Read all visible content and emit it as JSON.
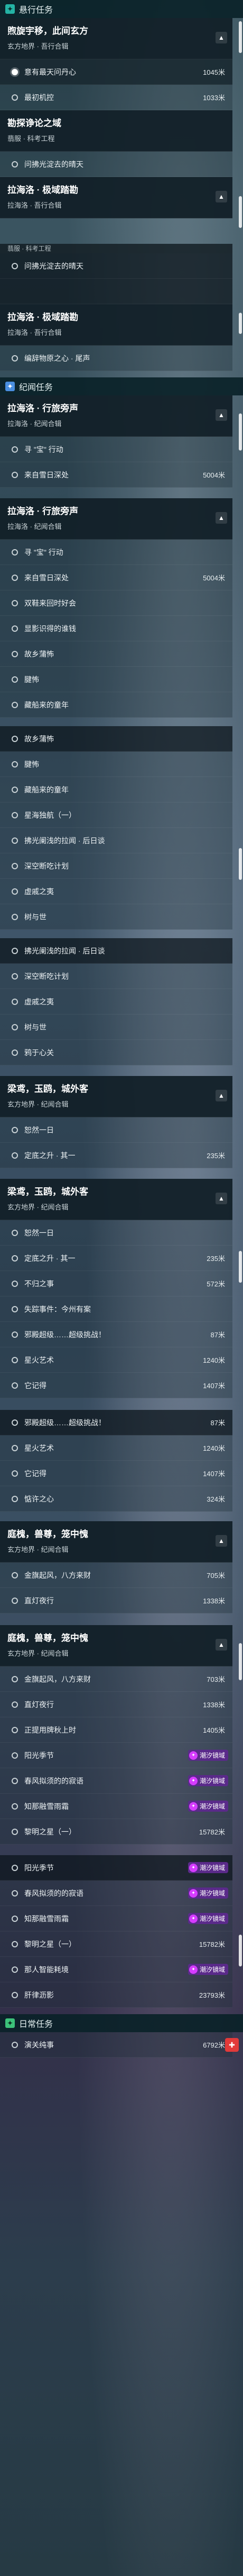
{
  "sections": {
    "daily": "悬行任务",
    "legend": "纪闻任务",
    "routine": "日常任务"
  },
  "quests": {
    "q1": {
      "title": "煦旋宇移，此间玄方",
      "sub": "玄方地界 · 吾行合辑"
    },
    "q2": {
      "title": "勘探诤论之域",
      "sub": "翡服 · 科考工程"
    },
    "q3": {
      "title": "拉海洛 · 极域踏勘",
      "sub": "拉海洛 · 吾行合辑"
    },
    "q4": {
      "title": "拉海洛 · 极域踏勘",
      "sub": "拉海洛 · 吾行合辑"
    },
    "q5": {
      "title": "拉海洛 · 行旅旁声",
      "sub": "拉海洛 · 纪闻合辑"
    },
    "q6": {
      "title": "拉海洛 · 行旅旁声",
      "sub": "拉海洛 · 纪闻合辑"
    },
    "q7": {
      "title": "梁鸢，玉鸥，城外客",
      "sub": "玄方地界 · 纪闻合辑"
    },
    "q8": {
      "title": "梁鸢，玉鸥，城外客",
      "sub": "玄方地界 · 纪闻合辑"
    },
    "q9": {
      "title": "庭槐，兽尊，笼中愧",
      "sub": "玄方地界 · 纪闻合辑"
    },
    "q10": {
      "title": "庭槐，兽尊，笼中愧",
      "sub": "玄方地界 · 纪闻合辑"
    }
  },
  "partial": {
    "p1": "翡服 · 科考工程"
  },
  "rows": {
    "r1": {
      "label": "意有最天问丹心",
      "dist": "1045米"
    },
    "r2": {
      "label": "最初机控",
      "dist": "1033米"
    },
    "r3": {
      "label": "问拂光淀去的晴天",
      "dist": ""
    },
    "r4": {
      "label": "问拂光淀去的晴天",
      "dist": ""
    },
    "r5": {
      "label": "编辞物原之心 · 尾声",
      "dist": ""
    },
    "r6": {
      "label": "寻 \"宝\" 行动",
      "dist": ""
    },
    "r7": {
      "label": "来自雪日深处",
      "dist": "5004米"
    },
    "r8": {
      "label": "寻 \"宝\" 行动",
      "dist": ""
    },
    "r9": {
      "label": "来自雪日深处",
      "dist": "5004米"
    },
    "r10": {
      "label": "双鞋来回时好会",
      "dist": ""
    },
    "r11": {
      "label": "显影识得的谁钱",
      "dist": ""
    },
    "r12": {
      "label": "故乡蒲怖",
      "dist": ""
    },
    "r13": {
      "label": "腱怖",
      "dist": ""
    },
    "r14": {
      "label": "藏船来的童年",
      "dist": ""
    },
    "r15": {
      "label": "故乡蒲怖",
      "dist": ""
    },
    "r16": {
      "label": "腱怖",
      "dist": ""
    },
    "r17": {
      "label": "藏船来的童年",
      "dist": ""
    },
    "r18": {
      "label": "星海独航（一）",
      "dist": ""
    },
    "r19": {
      "label": "拂光阑浅的拉闻 · 后日谈",
      "dist": ""
    },
    "r20": {
      "label": "深空断吃计划",
      "dist": ""
    },
    "r21": {
      "label": "虚戚之夷",
      "dist": ""
    },
    "r22": {
      "label": "树与世",
      "dist": ""
    },
    "r23": {
      "label": "拂光阑浅的拉闻 · 后日谈",
      "dist": ""
    },
    "r24": {
      "label": "深空断吃计划",
      "dist": ""
    },
    "r25": {
      "label": "虚戚之夷",
      "dist": ""
    },
    "r26": {
      "label": "树与世",
      "dist": ""
    },
    "r27": {
      "label": "鸦于心关",
      "dist": ""
    },
    "r28": {
      "label": "恕然一日",
      "dist": ""
    },
    "r29": {
      "label": "定底之升 · 其一",
      "dist": "235米"
    },
    "r30": {
      "label": "恕然一日",
      "dist": ""
    },
    "r31": {
      "label": "定底之升 · 其一",
      "dist": "235米"
    },
    "r32": {
      "label": "不归之事",
      "dist": "572米"
    },
    "r33": {
      "label": "失踪事件：今州有案",
      "dist": ""
    },
    "r34": {
      "label": "邪殿超级……超级挑战！",
      "dist": "87米"
    },
    "r35": {
      "label": "星火艺术",
      "dist": "1240米"
    },
    "r36": {
      "label": "它记得",
      "dist": "1407米"
    },
    "r37": {
      "label": "邪殿超级……超级挑战！",
      "dist": "87米"
    },
    "r38": {
      "label": "星火艺术",
      "dist": "1240米"
    },
    "r39": {
      "label": "它记得",
      "dist": "1407米"
    },
    "r40": {
      "label": "惦许之心",
      "dist": "324米"
    },
    "r41": {
      "label": "金旗起风，八方来财",
      "dist": "705米"
    },
    "r42": {
      "label": "直灯夜行",
      "dist": "1338米"
    },
    "r43": {
      "label": "金旗起风，八方来财",
      "dist": "703米"
    },
    "r44": {
      "label": "直灯夜行",
      "dist": "1338米"
    },
    "r45": {
      "label": "正提用牌秋上时",
      "dist": "1405米"
    },
    "r46": {
      "label": "阳光季节",
      "dist": ""
    },
    "r47": {
      "label": "春风拟须的的寂语",
      "dist": ""
    },
    "r48": {
      "label": "知那融雪雨霜",
      "dist": ""
    },
    "r49": {
      "label": "黎明之星（一）",
      "dist": "15782米"
    },
    "r50": {
      "label": "阳光季节",
      "dist": ""
    },
    "r51": {
      "label": "春风拟须的的寂语",
      "dist": ""
    },
    "r52": {
      "label": "知那融雪雨霜",
      "dist": ""
    },
    "r53": {
      "label": "黎明之星（一）",
      "dist": "15782米"
    },
    "r54": {
      "label": "那人智能耗境",
      "dist": ""
    },
    "r55": {
      "label": "肝律沥影",
      "dist": "23793米"
    },
    "r56": {
      "label": "演关纯事",
      "dist": "6792米"
    }
  },
  "badge": {
    "label": "潮汐镜域"
  },
  "icons": {
    "section": "task-icon",
    "chevron": "chevron-up-icon",
    "badge": "tide-icon",
    "gift": "gift-icon"
  },
  "colors": {
    "section_teal": "#24b3a4",
    "badge_purple": "#5a2a8a",
    "gift_red": "#e23a3a"
  }
}
